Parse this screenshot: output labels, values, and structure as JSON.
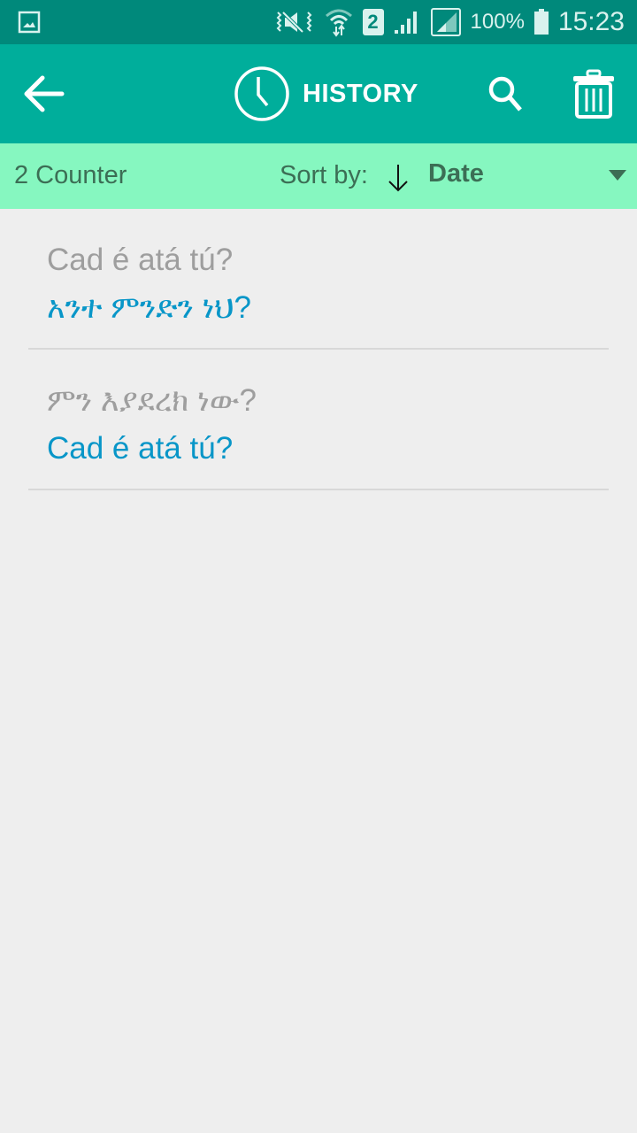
{
  "status_bar": {
    "icons": [
      "gallery-icon",
      "mute-vibrate-icon",
      "wifi-icon",
      "sim-2-icon",
      "signal-icon",
      "signal-sim2-icon",
      "battery-icon"
    ],
    "sim_label": "2",
    "battery": "100%",
    "time": "15:23"
  },
  "toolbar": {
    "title": "HISTORY",
    "back_icon": "arrow-left-icon",
    "title_icon": "clock-icon",
    "search_icon": "search-icon",
    "delete_icon": "trash-icon"
  },
  "sortbar": {
    "counter": "2 Counter",
    "sort_label": "Sort by:",
    "sort_direction": "descending",
    "sort_value": "Date"
  },
  "history": [
    {
      "source": "Cad é atá tú?",
      "translation": "አንተ ምንድን ነህ?"
    },
    {
      "source": "ምን እያደረክ ነው?",
      "translation": "Cad é atá tú?"
    }
  ],
  "colors": {
    "status_bar": "#00897b",
    "toolbar": "#00ae9b",
    "sortbar": "#86f7c0",
    "source_text": "#9e9e9e",
    "translation_text": "#0896c8"
  }
}
